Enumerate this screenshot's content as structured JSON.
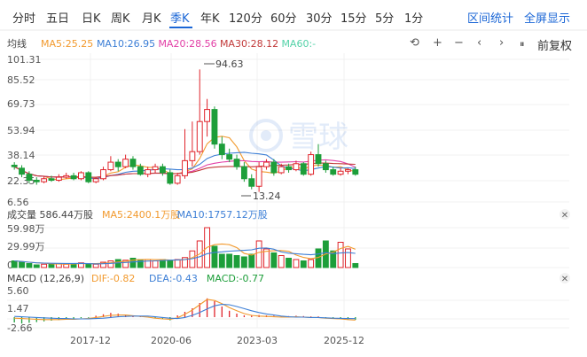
{
  "tabs": [
    {
      "label": "分时",
      "active": false
    },
    {
      "label": "五日",
      "active": false
    },
    {
      "label": "日K",
      "active": false
    },
    {
      "label": "周K",
      "active": false
    },
    {
      "label": "月K",
      "active": false
    },
    {
      "label": "季K",
      "active": true
    },
    {
      "label": "年K",
      "active": false
    },
    {
      "label": "120分",
      "active": false
    },
    {
      "label": "60分",
      "active": false
    },
    {
      "label": "30分",
      "active": false
    },
    {
      "label": "15分",
      "active": false
    },
    {
      "label": "5分",
      "active": false
    },
    {
      "label": "1分",
      "active": false
    }
  ],
  "header_actions": {
    "interval_stats": "区间统计",
    "fullscreen": "全屏显示"
  },
  "colors": {
    "up": "#e0242b",
    "down": "#1d9e3a",
    "ma5": "#f29a2e",
    "ma10": "#3d7fd6",
    "ma20": "#e23fa6",
    "ma30": "#c23a3a",
    "ma60": "#54d2a8",
    "dif": "#f29a2e",
    "dea": "#3d7fd6",
    "accent": "#1a66d6"
  },
  "main": {
    "label": "均线",
    "ma": [
      {
        "text": "MA5:25.25",
        "color": "#f29a2e"
      },
      {
        "text": "MA10:26.95",
        "color": "#3d7fd6"
      },
      {
        "text": "MA20:28.56",
        "color": "#e23fa6"
      },
      {
        "text": "MA30:28.12",
        "color": "#c23a3a"
      },
      {
        "text": "MA60:-",
        "color": "#54d2a8"
      }
    ],
    "tools": {
      "restore": "⟲",
      "zoom_in": "+",
      "zoom_out": "−",
      "left": "‹",
      "right": "›",
      "split": "⏸"
    },
    "adjust_label": "前复权",
    "yticks": [
      "101.31",
      "85.52",
      "69.73",
      "53.94",
      "38.14",
      "22.35",
      "6.56"
    ],
    "max_label": "94.63",
    "min_label": "13.24"
  },
  "volume": {
    "label": "成交量 586.44万股",
    "ma": [
      {
        "text": "MA5:2400.1万股",
        "color": "#f29a2e"
      },
      {
        "text": "MA10:1757.12万股",
        "color": "#3d7fd6"
      }
    ],
    "yticks": [
      "59.98万",
      "29.99万",
      "0"
    ]
  },
  "macd": {
    "label": "MACD (12,26,9)",
    "vals": [
      {
        "text": "DIF:-0.82",
        "color": "#f29a2e"
      },
      {
        "text": "DEA:-0.43",
        "color": "#3d7fd6"
      },
      {
        "text": "MACD:-0.77",
        "color": "#1d9e3a"
      }
    ],
    "yticks": [
      "5.60",
      "1.47",
      "-2.66"
    ]
  },
  "xticks": [
    "2017-12",
    "2020-06",
    "2023-03",
    "2025-12"
  ],
  "chart_data": {
    "type": "candlestick",
    "title": "",
    "period": "季K",
    "ylim": [
      6.56,
      101.31
    ],
    "candles": [
      [
        31,
        30,
        33,
        28
      ],
      [
        29,
        25,
        31,
        23
      ],
      [
        25,
        21,
        27,
        19
      ],
      [
        21,
        20,
        23,
        18
      ],
      [
        20,
        22,
        24,
        19
      ],
      [
        22,
        21,
        24,
        20
      ],
      [
        21,
        23,
        25,
        20
      ],
      [
        23,
        24,
        26,
        22
      ],
      [
        24,
        22,
        26,
        21
      ],
      [
        22,
        26,
        27,
        21
      ],
      [
        26,
        20,
        27,
        19
      ],
      [
        20,
        22,
        23,
        19
      ],
      [
        22,
        28,
        30,
        21
      ],
      [
        28,
        33,
        37,
        27
      ],
      [
        33,
        30,
        35,
        27
      ],
      [
        30,
        35,
        38,
        29
      ],
      [
        35,
        30,
        37,
        28
      ],
      [
        30,
        25,
        32,
        24
      ],
      [
        25,
        28,
        30,
        23
      ],
      [
        28,
        30,
        32,
        26
      ],
      [
        30,
        26,
        32,
        24
      ],
      [
        26,
        19,
        28,
        18
      ],
      [
        19,
        24,
        26,
        18
      ],
      [
        24,
        34,
        55,
        22
      ],
      [
        34,
        40,
        60,
        30
      ],
      [
        40,
        60,
        94.63,
        38
      ],
      [
        60,
        68,
        75,
        50
      ],
      [
        68,
        45,
        70,
        42
      ],
      [
        45,
        38,
        50,
        35
      ],
      [
        38,
        35,
        42,
        33
      ],
      [
        35,
        30,
        38,
        28
      ],
      [
        30,
        22,
        33,
        20
      ],
      [
        22,
        17,
        25,
        15
      ],
      [
        17,
        30,
        33,
        13.24
      ],
      [
        30,
        33,
        35,
        28
      ],
      [
        33,
        26,
        35,
        24
      ],
      [
        26,
        30,
        32,
        25
      ],
      [
        30,
        28,
        32,
        26
      ],
      [
        28,
        32,
        34,
        27
      ],
      [
        32,
        25,
        33,
        24
      ],
      [
        25,
        38,
        40,
        24
      ],
      [
        38,
        32,
        45,
        30
      ],
      [
        32,
        28,
        34,
        26
      ],
      [
        28,
        25,
        30,
        24
      ],
      [
        25,
        27,
        29,
        24
      ],
      [
        27,
        28,
        29,
        25
      ],
      [
        28,
        25,
        30,
        24
      ]
    ],
    "volume_max": 59.98,
    "volume": [
      10,
      8,
      6,
      4,
      5,
      5,
      6,
      5,
      6,
      7,
      6,
      5,
      8,
      10,
      12,
      11,
      14,
      12,
      12,
      10,
      12,
      10,
      12,
      15,
      25,
      40,
      59.98,
      32,
      20,
      20,
      18,
      16,
      20,
      40,
      28,
      22,
      18,
      14,
      12,
      10,
      12,
      28,
      40,
      25,
      38,
      28,
      6
    ],
    "macd": {
      "ylim": [
        -3.5,
        6.5
      ],
      "hist": [
        -1.5,
        -1.8,
        -1.6,
        -1.4,
        -1.2,
        -1.0,
        -0.8,
        -0.6,
        -0.4,
        -0.3,
        -0.2,
        0.4,
        0.8,
        1.2,
        1.0,
        0.6,
        0.5,
        0.3,
        0.1,
        -0.3,
        -0.6,
        -0.9,
        0.5,
        1.5,
        2.5,
        4.0,
        5.3,
        4.5,
        3.0,
        1.8,
        1.0,
        0.5,
        0.4,
        0.6,
        0.5,
        0.4,
        0.3,
        0.3,
        0.4,
        0.3,
        0.2,
        0.2,
        -0.1,
        -0.2,
        -0.4,
        -0.6,
        -0.77
      ],
      "dif": [
        -0.3,
        -0.4,
        -0.5,
        -0.6,
        -0.7,
        -0.7,
        -0.7,
        -0.6,
        -0.6,
        -0.5,
        -0.4,
        -0.1,
        0.2,
        0.5,
        0.6,
        0.6,
        0.4,
        0.2,
        0.0,
        -0.3,
        -0.5,
        -0.6,
        -0.2,
        0.8,
        2.0,
        3.5,
        5.0,
        4.7,
        3.8,
        2.7,
        1.8,
        1.0,
        0.5,
        0.3,
        0.2,
        0.1,
        0.0,
        0.0,
        0.1,
        0.0,
        -0.1,
        -0.1,
        -0.3,
        -0.4,
        -0.5,
        -0.7,
        -0.82
      ],
      "dea": [
        0.2,
        0.1,
        0.0,
        -0.1,
        -0.2,
        -0.3,
        -0.4,
        -0.4,
        -0.5,
        -0.5,
        -0.5,
        -0.4,
        -0.3,
        -0.1,
        0.1,
        0.2,
        0.3,
        0.3,
        0.3,
        0.1,
        -0.1,
        -0.3,
        -0.4,
        -0.1,
        0.5,
        1.3,
        2.3,
        3.2,
        3.6,
        3.5,
        3.0,
        2.4,
        1.8,
        1.3,
        0.9,
        0.6,
        0.3,
        0.1,
        0.0,
        0.0,
        -0.1,
        -0.1,
        -0.2,
        -0.3,
        -0.35,
        -0.4,
        -0.43
      ]
    }
  }
}
